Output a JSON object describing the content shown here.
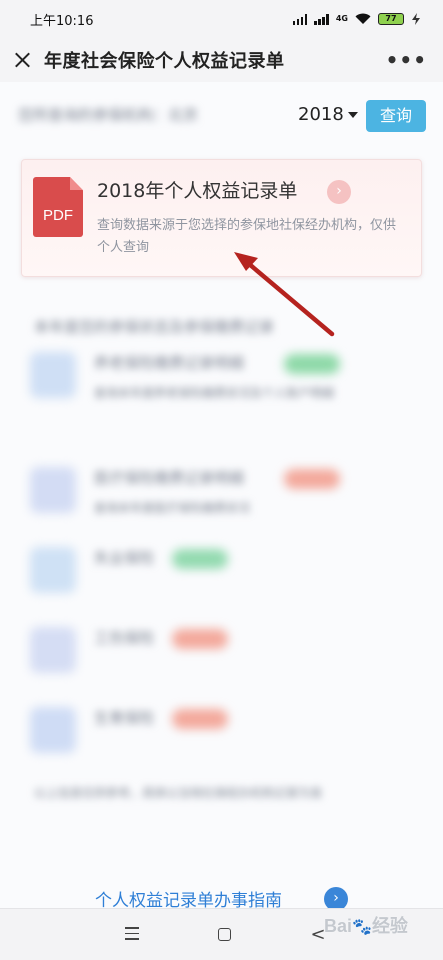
{
  "status_bar": {
    "time": "上午10:16",
    "network": "4G",
    "battery": "77"
  },
  "app_bar": {
    "title": "年度社会保险个人权益记录单",
    "more": "•••"
  },
  "filter": {
    "left_text": "您所查询的参保机构：北京",
    "year": "2018",
    "query_button": "查询"
  },
  "pdf_card": {
    "icon_label": "PDF",
    "title": "2018年个人权益记录单",
    "arrow": "›",
    "description": "查询数据来源于您选择的参保地社保经办机构，仅供个人查询"
  },
  "section": {
    "heading": "本年度您的参保状态及参保缴费记录"
  },
  "list_items": [
    {
      "text": "养老保险缴费记录明细",
      "sub": "查询本年度养老保险缴费状况及个人账户明细"
    },
    {
      "text": "医疗保险缴费记录明细",
      "sub": "查询本年度医疗保险缴费状况"
    },
    {
      "text": "失业保险",
      "sub": ""
    },
    {
      "text": "工伤保险",
      "sub": ""
    },
    {
      "text": "生育保险",
      "sub": ""
    }
  ],
  "footer_note": "以上信息仅供参考，具体以当地社保经办机构记录为准",
  "guide": {
    "label": "个人权益记录单办事指南",
    "arrow": "›"
  },
  "nav": {
    "back": "<"
  },
  "watermark": {
    "text": "Bai",
    "text2": "经验"
  },
  "colors": {
    "accent": "#4cb4e2",
    "pdf_red": "#d94c4c",
    "link_blue": "#2f7fd6",
    "annotation": "#b5231f"
  }
}
